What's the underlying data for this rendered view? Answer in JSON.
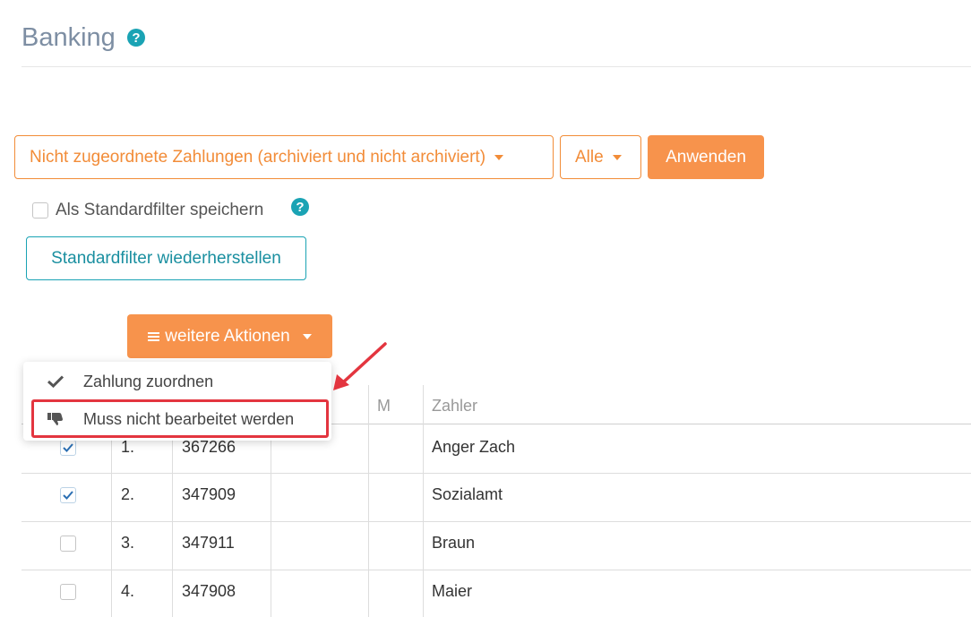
{
  "page": {
    "title": "Banking"
  },
  "filters": {
    "payment_filter": "Nicht zugeordnete Zahlungen (archiviert und nicht archiviert)",
    "scope_filter": "Alle",
    "apply_label": "Anwenden",
    "save_default_label": "Als Standardfilter speichern",
    "restore_default_label": "Standardfilter wiederherstellen"
  },
  "actions": {
    "more_label": "weitere Aktionen",
    "menu": [
      {
        "label": "Zahlung zuordnen",
        "icon": "check-icon"
      },
      {
        "label": "Muss nicht bearbeitet werden",
        "icon": "thumbs-down-icon"
      }
    ]
  },
  "table": {
    "columns": [
      "M",
      "Zahler"
    ],
    "rows": [
      {
        "checked": true,
        "index": "1.",
        "number": "367266",
        "payer": "Anger Zach"
      },
      {
        "checked": true,
        "index": "2.",
        "number": "347909",
        "payer": "Sozialamt"
      },
      {
        "checked": false,
        "index": "3.",
        "number": "347911",
        "payer": "Braun"
      },
      {
        "checked": false,
        "index": "4.",
        "number": "347908",
        "payer": "Maier"
      }
    ]
  },
  "colors": {
    "accent_orange": "#f28c38",
    "teal": "#1aa3b4",
    "highlight_red": "#e3353f"
  }
}
